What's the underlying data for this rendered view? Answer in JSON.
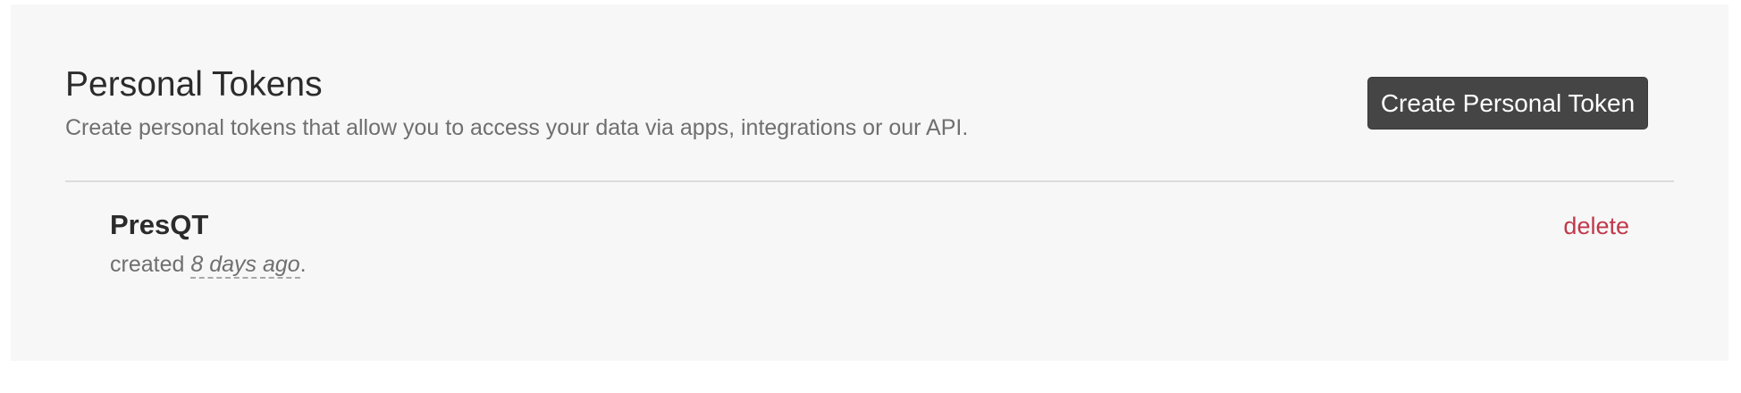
{
  "header": {
    "title": "Personal Tokens",
    "subtitle": "Create personal tokens that allow you to access your data via apps, integrations or our API.",
    "create_button_label": "Create Personal Token"
  },
  "tokens": [
    {
      "name": "PresQT",
      "created_prefix": "created",
      "created_relative": "8 days ago",
      "created_suffix": ".",
      "delete_label": "delete"
    }
  ],
  "colors": {
    "panel_background": "#f7f7f7",
    "button_background": "#454545",
    "delete_link": "#c0394b"
  }
}
